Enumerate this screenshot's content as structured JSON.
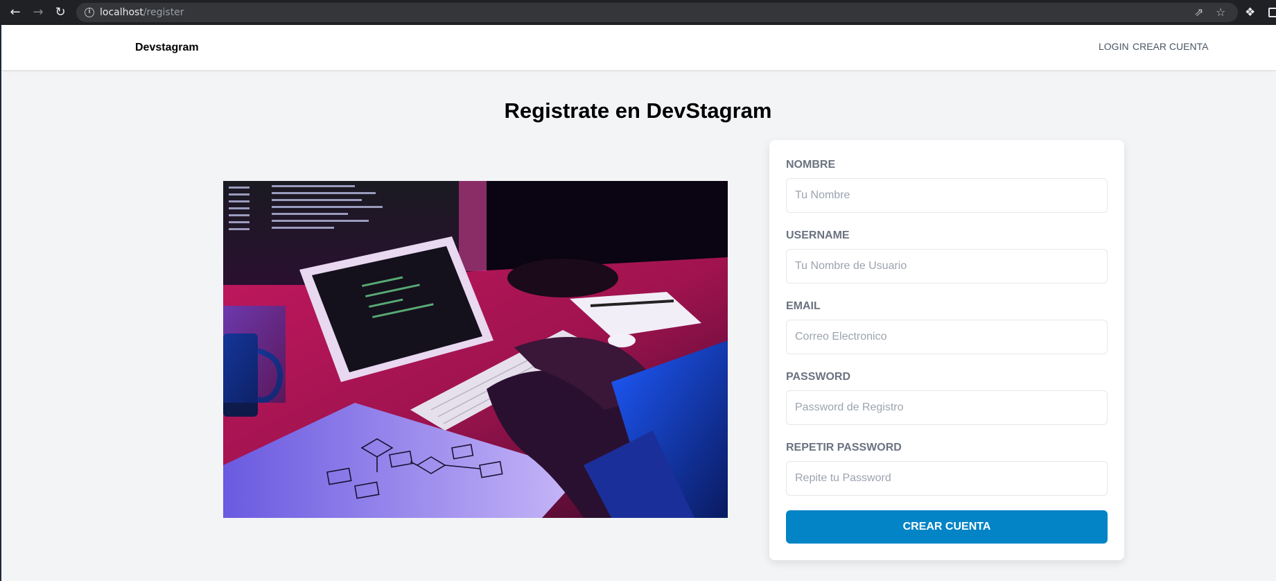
{
  "browser": {
    "url_host": "localhost",
    "url_path": "/register",
    "back_icon": "arrow-left-icon",
    "forward_icon": "arrow-right-icon",
    "reload_icon": "reload-icon"
  },
  "header": {
    "logo": "Devstagram",
    "nav": {
      "login": "LOGIN",
      "register": "CREAR CUENTA"
    }
  },
  "page": {
    "title": "Registrate en DevStagram"
  },
  "form": {
    "fields": [
      {
        "label": "NOMBRE",
        "placeholder": "Tu Nombre",
        "value": ""
      },
      {
        "label": "USERNAME",
        "placeholder": "Tu Nombre de Usuario",
        "value": ""
      },
      {
        "label": "EMAIL",
        "placeholder": "Correo Electronico",
        "value": ""
      },
      {
        "label": "PASSWORD",
        "placeholder": "Password de Registro",
        "value": ""
      },
      {
        "label": "REPETIR PASSWORD",
        "placeholder": "Repite tu Password",
        "value": ""
      }
    ],
    "submit_label": "CREAR CUENTA"
  },
  "colors": {
    "accent": "#0284c7",
    "page_background": "#f3f4f6",
    "label": "#6b7280"
  }
}
